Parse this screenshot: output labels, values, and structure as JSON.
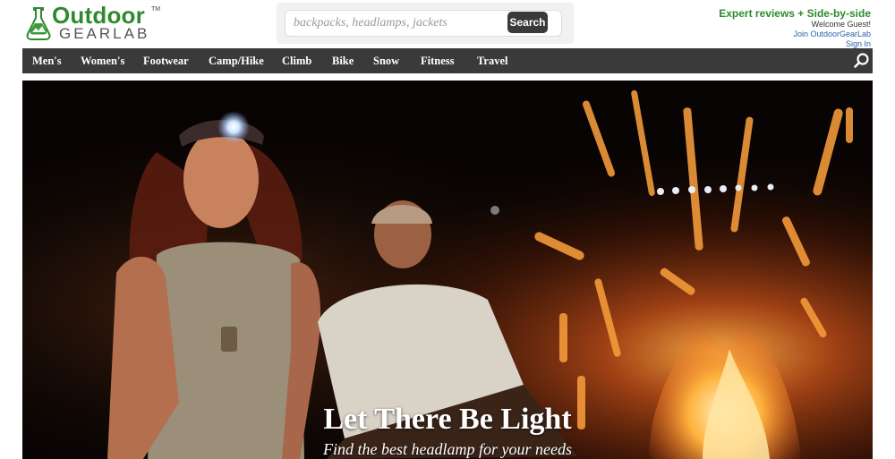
{
  "logo": {
    "word1": "Outdoor",
    "word2": "GEARLAB",
    "tm": "TM"
  },
  "search": {
    "placeholder": "backpacks, headlamps, jackets",
    "button_label": "Search"
  },
  "top_right": {
    "tagline": "Expert reviews + Side-by-side",
    "welcome": "Welcome Guest!",
    "join": "Join OutdoorGearLab",
    "signin": "Sign In"
  },
  "nav": {
    "items": [
      "Men's",
      "Women's",
      "Footwear",
      "Camp/Hike",
      "Climb",
      "Bike",
      "Snow",
      "Fitness",
      "Travel"
    ],
    "search_icon": "search-icon"
  },
  "hero": {
    "title": "Let There Be Light",
    "subtitle": "Find the best headlamp for your needs"
  },
  "colors": {
    "brand_green": "#2f8a2f",
    "nav_bg": "#3a3a3a",
    "link_blue": "#2a63a8"
  }
}
